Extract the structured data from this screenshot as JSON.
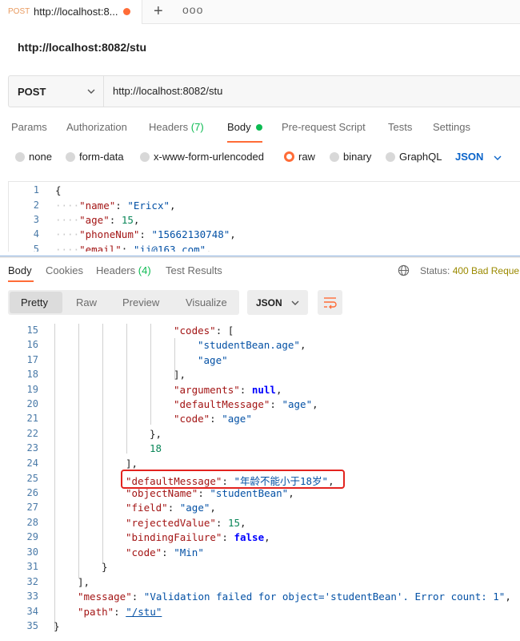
{
  "tab": {
    "method": "POST",
    "title": "http://localhost:8...",
    "new_tab": "+",
    "more": "ooo"
  },
  "request": {
    "name": "http://localhost:8082/stu",
    "method": "POST",
    "url": "http://localhost:8082/stu"
  },
  "request_tabs": [
    {
      "label": "Params"
    },
    {
      "label": "Authorization"
    },
    {
      "label": "Headers",
      "count": "(7)"
    },
    {
      "label": "Body"
    },
    {
      "label": "Pre-request Script"
    },
    {
      "label": "Tests"
    },
    {
      "label": "Settings"
    }
  ],
  "body_types": [
    {
      "label": "none"
    },
    {
      "label": "form-data"
    },
    {
      "label": "x-www-form-urlencoded"
    },
    {
      "label": "raw"
    },
    {
      "label": "binary"
    },
    {
      "label": "GraphQL"
    }
  ],
  "body_language": "JSON",
  "request_body": {
    "line_numbers": [
      "1",
      "2",
      "3",
      "4",
      "5"
    ],
    "l1": "{",
    "l2_key": "\"name\"",
    "l2_val": "\"Ericx\"",
    "l3_key": "\"age\"",
    "l3_val": "15",
    "l4_key": "\"phoneNum\"",
    "l4_val": "\"15662130748\"",
    "l5_key": "\"email\"",
    "l5_val": "\"jj@163.com\""
  },
  "response_tabs": [
    {
      "label": "Body"
    },
    {
      "label": "Cookies"
    },
    {
      "label": "Headers",
      "count": "(4)"
    },
    {
      "label": "Test Results"
    }
  ],
  "status": {
    "label": "Status:",
    "value": "400 Bad Reque"
  },
  "view_modes": [
    "Pretty",
    "Raw",
    "Preview",
    "Visualize"
  ],
  "view_format": "JSON",
  "response_body": {
    "line_numbers": [
      "15",
      "16",
      "17",
      "18",
      "19",
      "20",
      "21",
      "22",
      "23",
      "24",
      "25",
      "26",
      "27",
      "28",
      "29",
      "30",
      "31",
      "32",
      "33",
      "34",
      "35"
    ],
    "codes_key": "\"codes\"",
    "codes_0": "\"studentBean.age\"",
    "codes_1": "\"age\"",
    "arguments_key": "\"arguments\"",
    "arguments_val": "null",
    "inner_default_key": "\"defaultMessage\"",
    "inner_default_val": "\"age\"",
    "inner_code_key": "\"code\"",
    "inner_code_val": "\"age\"",
    "num_18": "18",
    "default_key": "\"defaultMessage\"",
    "default_val": "\"年龄不能小于18岁\"",
    "object_key": "\"objectName\"",
    "object_val": "\"studentBean\"",
    "field_key": "\"field\"",
    "field_val": "\"age\"",
    "rejected_key": "\"rejectedValue\"",
    "rejected_val": "15",
    "binding_key": "\"bindingFailure\"",
    "binding_val": "false",
    "code_key": "\"code\"",
    "code_val": "\"Min\"",
    "message_key": "\"message\"",
    "message_val": "\"Validation failed for object='studentBean'. Error count: 1\"",
    "path_key": "\"path\"",
    "path_val": "\"/stu\""
  }
}
